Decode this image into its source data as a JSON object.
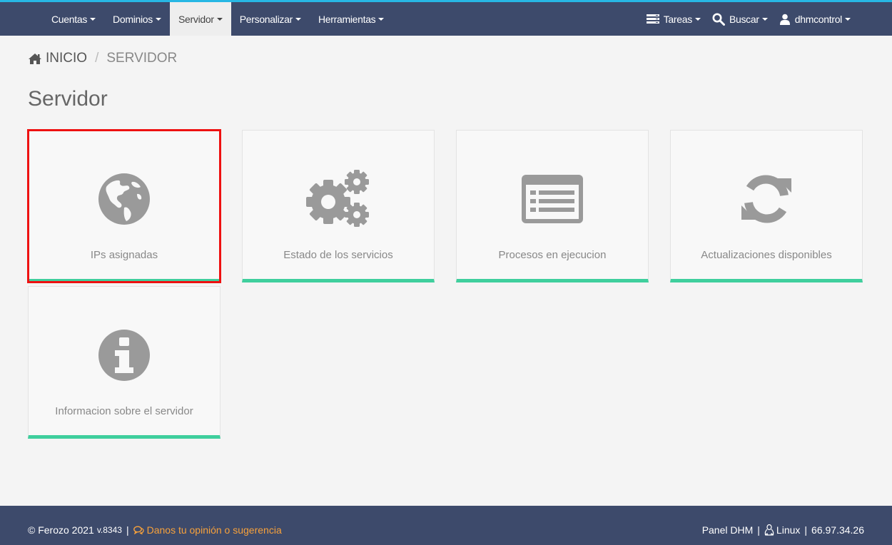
{
  "nav": {
    "items": [
      {
        "label": "Cuentas",
        "active": false
      },
      {
        "label": "Dominios",
        "active": false
      },
      {
        "label": "Servidor",
        "active": true
      },
      {
        "label": "Personalizar",
        "active": false
      },
      {
        "label": "Herramientas",
        "active": false
      }
    ],
    "right": {
      "tasks_label": "Tareas",
      "search_label": "Buscar",
      "user_label": "dhmcontrol"
    }
  },
  "breadcrumb": {
    "home": "INICIO",
    "separator": "/",
    "current": "SERVIDOR"
  },
  "page_title": "Servidor",
  "cards": [
    {
      "label": "IPs asignadas",
      "icon": "globe-icon",
      "selected": true
    },
    {
      "label": "Estado de los servicios",
      "icon": "gears-icon",
      "selected": false
    },
    {
      "label": "Procesos en ejecucion",
      "icon": "list-alt-icon",
      "selected": false
    },
    {
      "label": "Actualizaciones disponibles",
      "icon": "refresh-icon",
      "selected": false
    },
    {
      "label": "Informacion sobre el servidor",
      "icon": "info-circle-icon",
      "selected": false
    }
  ],
  "footer": {
    "copyright": "© Ferozo 2021",
    "version": "v.8343",
    "separator": "|",
    "feedback_link": "Danos tu opinión o sugerencia",
    "panel": "Panel DHM",
    "os": "Linux",
    "ip": "66.97.34.26"
  },
  "colors": {
    "topbar": "#3d4a6b",
    "topbar_accent": "#27b7e4",
    "card_accent": "#3fcf9d",
    "selection": "#ee1111",
    "link": "#f7a13b",
    "icon": "#9a9a9a"
  }
}
